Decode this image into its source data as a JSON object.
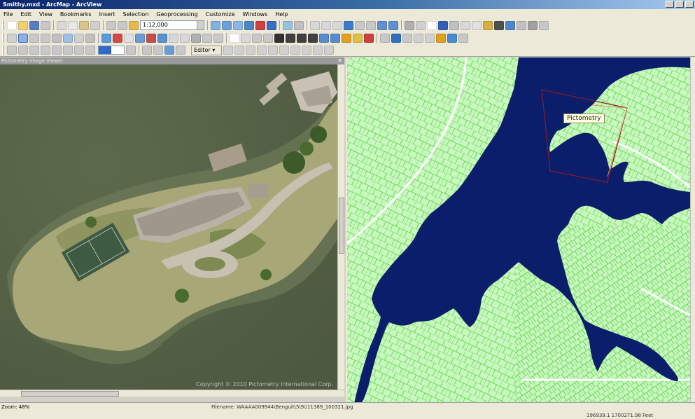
{
  "window": {
    "title": "Smithy.mxd - ArcMap - ArcView"
  },
  "menu": [
    "File",
    "Edit",
    "View",
    "Bookmarks",
    "Insert",
    "Selection",
    "Geoprocessing",
    "Customize",
    "Windows",
    "Help"
  ],
  "toolbar": {
    "scale": "1:12,000",
    "editor_label": "Editor ▾"
  },
  "left_pane": {
    "title": "Pictometry Image Viewer",
    "copyright": "Copyright © 2010 Pictometry International Corp."
  },
  "right_pane": {
    "map_label": "Pictometry"
  },
  "statusbar": {
    "zoom": "Zoom: 48%",
    "filename": "Filename: WAAAA009944\\Benguit\\5\\9\\\\11389_100321.jpg",
    "coordinates": "196939.1  1700271.98 Feet"
  },
  "colors": {
    "water": "#0b1e6b",
    "land": "#c8f7c0",
    "parcel_lines": "#5ad63f",
    "aerial_water": "#56644a",
    "footprint": "#8b1a2a"
  },
  "icons": {
    "aerial_image": "aerial-photo",
    "map": "parcel-map"
  }
}
